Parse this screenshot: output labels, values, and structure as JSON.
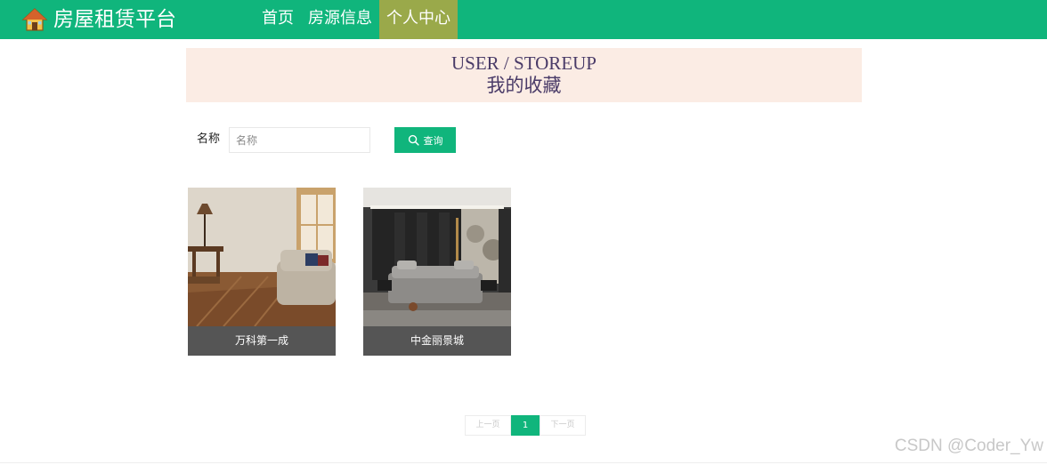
{
  "app": {
    "title": "房屋租赁平台",
    "logo_icon": "house-logo-icon"
  },
  "nav": {
    "items": [
      {
        "label": "首页",
        "active": false
      },
      {
        "label": "房源信息",
        "active": false
      },
      {
        "label": "个人中心",
        "active": true
      }
    ]
  },
  "hero": {
    "title_en": "USER / STOREUP",
    "title_cn": "我的收藏"
  },
  "search": {
    "label": "名称",
    "placeholder": "名称",
    "value": "",
    "button_label": "查询",
    "button_icon": "search-icon"
  },
  "favorites": [
    {
      "name": "万科第一成",
      "image": "living-room-photo"
    },
    {
      "name": "中金丽景城",
      "image": "bedroom-photo"
    }
  ],
  "pagination": {
    "prev_label": "上一页",
    "current_page": "1",
    "next_label": "下一页"
  },
  "watermark": "CSDN @Coder_Yw",
  "colors": {
    "primary": "#10b57c",
    "nav_active": "#9aa94a",
    "hero_bg": "#fbece4",
    "caption_bg": "#555555"
  }
}
